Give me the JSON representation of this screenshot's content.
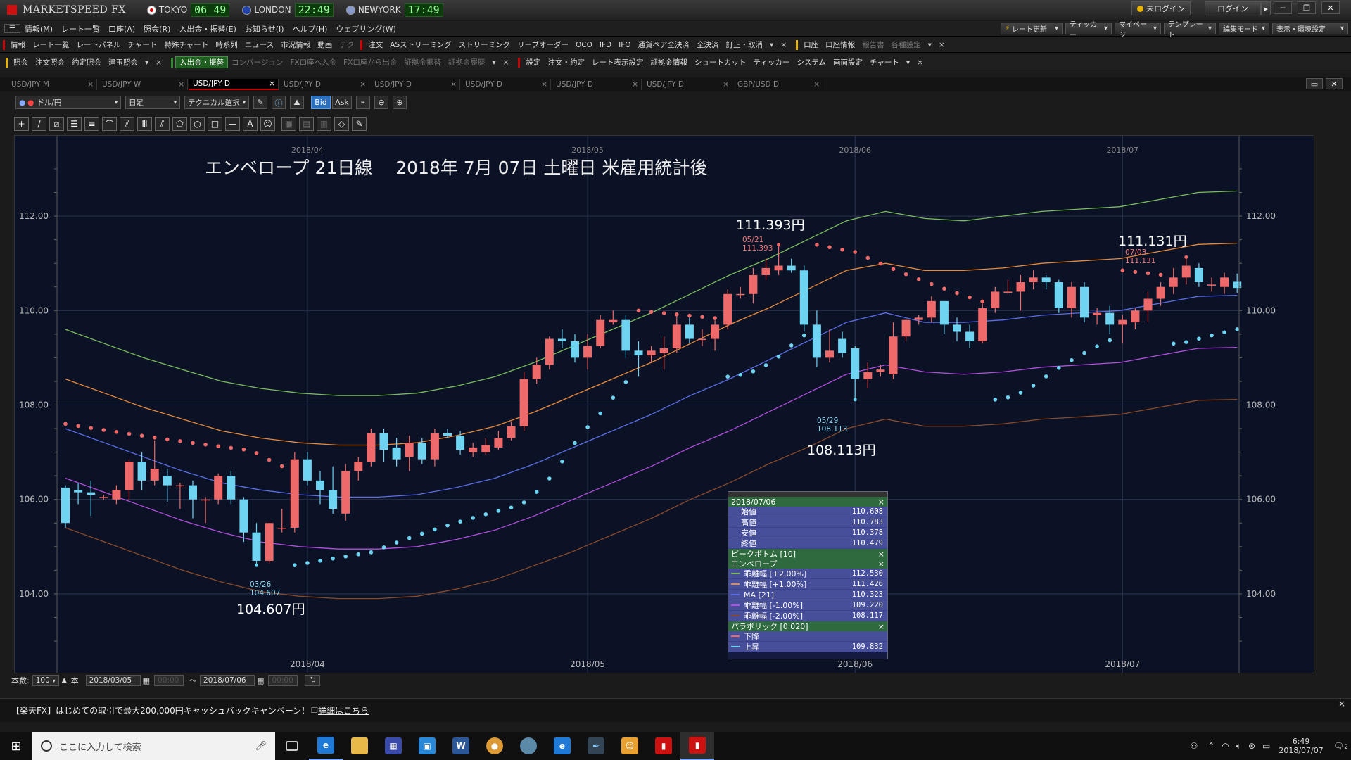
{
  "titlebar": {
    "app_name": "MARKETSPEED FX",
    "clocks": [
      {
        "city": "TOKYO",
        "time": "06 49",
        "flag_color": "#d00"
      },
      {
        "city": "LONDON",
        "time": "22:49",
        "flag_color": "#2244aa"
      },
      {
        "city": "NEWYORK",
        "time": "17:49",
        "flag_color": "#8899cc"
      }
    ],
    "login_status": "未ログイン",
    "login_button": "ログイン",
    "more": "▸",
    "minimize": "─",
    "restore": "❐",
    "close": "✕"
  },
  "menubar": {
    "items": [
      "情報(M)",
      "レート一覧",
      "口座(A)",
      "照会(R)",
      "入出金・振替(E)",
      "お知らせ(I)",
      "ヘルプ(H)",
      "ウェブリング(W)"
    ],
    "right_buttons": [
      "レート更新",
      "ティッカー",
      "マイページ",
      "テンプレート",
      "編集モード",
      "表示・環境設定"
    ]
  },
  "toolbar1": {
    "group1_label": "情報",
    "group1_items": [
      "レート一覧",
      "レートパネル",
      "チャート",
      "特殊チャート",
      "時系列",
      "ニュース",
      "市況情報",
      "動画",
      "テク"
    ],
    "group2_label": "注文",
    "group2_items": [
      "ASストリーミング",
      "ストリーミング",
      "リーブオーダー",
      "OCO",
      "IFD",
      "IFO",
      "通貨ペア全決済",
      "全決済",
      "訂正・取消"
    ],
    "group3_label": "口座",
    "group3_items": [
      "口座情報",
      "報告書",
      "各種設定"
    ],
    "close": "×",
    "dropdown": "▾"
  },
  "toolbar2": {
    "group1_label": "照会",
    "group1_items": [
      "注文照会",
      "約定照会",
      "建玉照会"
    ],
    "group2_label": "入出金・振替",
    "group2_items": [
      "コンバージョン",
      "FX口座へ入金",
      "FX口座から出金",
      "証拠金振替",
      "証拠金履歴"
    ],
    "group3_label": "設定",
    "group3_items": [
      "注文・約定",
      "レート表示設定",
      "証拠金情報",
      "ショートカット",
      "ティッカー",
      "システム",
      "画面設定",
      "チャート"
    ],
    "close": "×",
    "dropdown": "▾"
  },
  "tabs": [
    {
      "label": "USD/JPY M",
      "active": false
    },
    {
      "label": "USD/JPY W",
      "active": false
    },
    {
      "label": "USD/JPY D",
      "active": true
    },
    {
      "label": "USD/JPY D",
      "active": false
    },
    {
      "label": "USD/JPY D",
      "active": false
    },
    {
      "label": "USD/JPY D",
      "active": false
    },
    {
      "label": "USD/JPY D",
      "active": false
    },
    {
      "label": "USD/JPY D",
      "active": false
    },
    {
      "label": "GBP/USD D",
      "active": false
    }
  ],
  "tab_close": "×",
  "window_controls": {
    "restore": "▭",
    "close": "✕"
  },
  "charttool": {
    "pair": "ドル/円",
    "period": "日足",
    "technical": "テクニカル選択",
    "bid": "Bid",
    "ask": "Ask",
    "arrow": "▾"
  },
  "drawtools": [
    "+",
    "/",
    "⧄",
    "☰",
    "≡",
    "⌒",
    "⫽",
    "Ⅲ",
    "⫽",
    "⬠",
    "○",
    "□",
    "—",
    "A",
    "☺",
    "▣",
    "▤",
    "▥",
    "◇",
    "✎"
  ],
  "chart": {
    "headline": "エンベロープ 21日線　 2018年 7月 07日 土曜日 米雇用統計後",
    "annotations": {
      "high": {
        "label": "111.393円",
        "date": "05/21",
        "value": "111.393"
      },
      "recent_high": {
        "label": "111.131円",
        "date": "07/03",
        "value": "111.131"
      },
      "low_may": {
        "label": "108.113円",
        "date": "05/29",
        "value": "108.113"
      },
      "low_mar": {
        "label": "104.607円",
        "date": "03/26",
        "value": "104.607"
      }
    },
    "colors": {
      "background": "#0c1226",
      "up_candle": "#ee6a6a",
      "down_candle": "#6fd3f2",
      "env_plus2": "#7bbd5c",
      "env_plus1": "#e88a3a",
      "ma": "#5b6ee8",
      "env_minus1": "#b34fe0",
      "env_minus2": "#8a4a2a",
      "sar_up": "#6fd3f2",
      "sar_down": "#ee6a6a"
    }
  },
  "chart_data": {
    "type": "candlestick",
    "symbol": "USD/JPY",
    "period": "日足",
    "x_range": [
      "2018-03-05",
      "2018-07-06"
    ],
    "x_ticks": [
      "2018/04",
      "2018/05",
      "2018/06",
      "2018/07"
    ],
    "y_ticks": [
      "104.00",
      "106.00",
      "108.00",
      "110.00",
      "112.00"
    ],
    "ylim": [
      102.3,
      113.7
    ],
    "grid": true,
    "candles": [
      {
        "o": 106.25,
        "h": 106.3,
        "l": 105.4,
        "c": 105.5
      },
      {
        "o": 106.2,
        "h": 106.35,
        "l": 105.9,
        "c": 106.15
      },
      {
        "o": 106.15,
        "h": 106.4,
        "l": 105.65,
        "c": 106.1
      },
      {
        "o": 106.05,
        "h": 106.1,
        "l": 106.0,
        "c": 106.05
      },
      {
        "o": 106.0,
        "h": 106.3,
        "l": 105.9,
        "c": 106.2
      },
      {
        "o": 106.2,
        "h": 106.85,
        "l": 106.0,
        "c": 106.8
      },
      {
        "o": 106.8,
        "h": 107.0,
        "l": 106.2,
        "c": 106.4
      },
      {
        "o": 106.4,
        "h": 107.25,
        "l": 106.3,
        "c": 106.65
      },
      {
        "o": 106.5,
        "h": 106.65,
        "l": 105.95,
        "c": 106.3
      },
      {
        "o": 106.3,
        "h": 106.35,
        "l": 105.8,
        "c": 106.3
      },
      {
        "o": 106.3,
        "h": 106.4,
        "l": 105.6,
        "c": 106.0
      },
      {
        "o": 106.0,
        "h": 106.05,
        "l": 105.5,
        "c": 106.0
      },
      {
        "o": 106.0,
        "h": 106.55,
        "l": 105.9,
        "c": 106.5
      },
      {
        "o": 106.5,
        "h": 106.6,
        "l": 105.9,
        "c": 106.0
      },
      {
        "o": 106.0,
        "h": 106.05,
        "l": 105.1,
        "c": 105.3
      },
      {
        "o": 105.3,
        "h": 105.5,
        "l": 104.607,
        "c": 104.7
      },
      {
        "o": 104.7,
        "h": 105.5,
        "l": 104.65,
        "c": 105.5
      },
      {
        "o": 105.4,
        "h": 105.8,
        "l": 105.3,
        "c": 105.4
      },
      {
        "o": 105.4,
        "h": 107.0,
        "l": 105.3,
        "c": 106.85
      },
      {
        "o": 106.85,
        "h": 107.0,
        "l": 106.3,
        "c": 106.4
      },
      {
        "o": 106.4,
        "h": 106.6,
        "l": 105.9,
        "c": 106.2
      },
      {
        "o": 106.2,
        "h": 106.7,
        "l": 105.7,
        "c": 105.8
      },
      {
        "o": 105.7,
        "h": 106.75,
        "l": 105.55,
        "c": 106.6
      },
      {
        "o": 106.6,
        "h": 106.9,
        "l": 106.4,
        "c": 106.8
      },
      {
        "o": 106.8,
        "h": 107.5,
        "l": 106.7,
        "c": 107.4
      },
      {
        "o": 107.4,
        "h": 107.5,
        "l": 106.8,
        "c": 107.05
      },
      {
        "o": 107.1,
        "h": 107.3,
        "l": 106.7,
        "c": 106.85
      },
      {
        "o": 106.9,
        "h": 107.35,
        "l": 106.6,
        "c": 107.2
      },
      {
        "o": 107.2,
        "h": 107.3,
        "l": 106.75,
        "c": 106.85
      },
      {
        "o": 106.85,
        "h": 107.5,
        "l": 106.7,
        "c": 107.4
      },
      {
        "o": 107.4,
        "h": 107.5,
        "l": 107.3,
        "c": 107.35
      },
      {
        "o": 107.35,
        "h": 107.45,
        "l": 106.95,
        "c": 107.05
      },
      {
        "o": 107.0,
        "h": 107.2,
        "l": 106.9,
        "c": 107.1
      },
      {
        "o": 107.0,
        "h": 107.3,
        "l": 106.95,
        "c": 107.15
      },
      {
        "o": 107.1,
        "h": 107.45,
        "l": 107.05,
        "c": 107.3
      },
      {
        "o": 107.3,
        "h": 107.65,
        "l": 107.25,
        "c": 107.55
      },
      {
        "o": 107.55,
        "h": 108.7,
        "l": 107.45,
        "c": 108.55
      },
      {
        "o": 108.55,
        "h": 109.0,
        "l": 108.45,
        "c": 108.85
      },
      {
        "o": 108.85,
        "h": 109.45,
        "l": 108.75,
        "c": 109.4
      },
      {
        "o": 109.4,
        "h": 109.6,
        "l": 109.2,
        "c": 109.35
      },
      {
        "o": 109.35,
        "h": 109.5,
        "l": 108.9,
        "c": 109.0
      },
      {
        "o": 109.0,
        "h": 109.5,
        "l": 108.75,
        "c": 109.25
      },
      {
        "o": 109.25,
        "h": 109.9,
        "l": 109.2,
        "c": 109.8
      },
      {
        "o": 109.75,
        "h": 110.0,
        "l": 109.7,
        "c": 109.8
      },
      {
        "o": 109.8,
        "h": 109.9,
        "l": 109.0,
        "c": 109.15
      },
      {
        "o": 109.15,
        "h": 109.35,
        "l": 108.6,
        "c": 109.05
      },
      {
        "o": 109.05,
        "h": 109.25,
        "l": 108.9,
        "c": 109.15
      },
      {
        "o": 109.1,
        "h": 109.45,
        "l": 108.75,
        "c": 109.2
      },
      {
        "o": 109.2,
        "h": 109.9,
        "l": 109.1,
        "c": 109.7
      },
      {
        "o": 109.7,
        "h": 109.85,
        "l": 109.3,
        "c": 109.4
      },
      {
        "o": 109.4,
        "h": 109.6,
        "l": 109.25,
        "c": 109.4
      },
      {
        "o": 109.4,
        "h": 109.8,
        "l": 109.15,
        "c": 109.7
      },
      {
        "o": 109.7,
        "h": 110.45,
        "l": 109.6,
        "c": 110.35
      },
      {
        "o": 110.35,
        "h": 110.5,
        "l": 110.25,
        "c": 110.35
      },
      {
        "o": 110.35,
        "h": 110.9,
        "l": 110.15,
        "c": 110.75
      },
      {
        "o": 110.75,
        "h": 111.1,
        "l": 110.65,
        "c": 110.9
      },
      {
        "o": 110.85,
        "h": 111.393,
        "l": 110.75,
        "c": 110.95
      },
      {
        "o": 110.95,
        "h": 111.1,
        "l": 110.8,
        "c": 110.85
      },
      {
        "o": 110.85,
        "h": 110.95,
        "l": 109.55,
        "c": 109.7
      },
      {
        "o": 109.7,
        "h": 110.0,
        "l": 108.8,
        "c": 109.0
      },
      {
        "o": 109.0,
        "h": 109.6,
        "l": 108.9,
        "c": 109.15
      },
      {
        "o": 109.4,
        "h": 109.55,
        "l": 109.0,
        "c": 109.1
      },
      {
        "o": 109.2,
        "h": 109.25,
        "l": 108.113,
        "c": 108.55
      },
      {
        "o": 108.55,
        "h": 108.9,
        "l": 108.35,
        "c": 108.7
      },
      {
        "o": 108.7,
        "h": 108.85,
        "l": 108.6,
        "c": 108.75
      },
      {
        "o": 108.65,
        "h": 109.75,
        "l": 108.55,
        "c": 109.45
      },
      {
        "o": 109.45,
        "h": 109.8,
        "l": 109.35,
        "c": 109.8
      },
      {
        "o": 109.8,
        "h": 109.9,
        "l": 109.7,
        "c": 109.85
      },
      {
        "o": 109.85,
        "h": 110.3,
        "l": 109.75,
        "c": 110.2
      },
      {
        "o": 110.2,
        "h": 110.2,
        "l": 109.5,
        "c": 109.7
      },
      {
        "o": 109.7,
        "h": 109.85,
        "l": 109.35,
        "c": 109.55
      },
      {
        "o": 109.55,
        "h": 109.7,
        "l": 109.2,
        "c": 109.35
      },
      {
        "o": 109.35,
        "h": 110.15,
        "l": 109.3,
        "c": 110.05
      },
      {
        "o": 110.05,
        "h": 110.5,
        "l": 109.95,
        "c": 110.4
      },
      {
        "o": 110.4,
        "h": 110.65,
        "l": 110.35,
        "c": 110.4
      },
      {
        "o": 110.4,
        "h": 110.75,
        "l": 110.0,
        "c": 110.6
      },
      {
        "o": 110.6,
        "h": 110.85,
        "l": 110.45,
        "c": 110.7
      },
      {
        "o": 110.7,
        "h": 110.75,
        "l": 110.45,
        "c": 110.6
      },
      {
        "o": 110.6,
        "h": 110.65,
        "l": 109.95,
        "c": 110.05
      },
      {
        "o": 110.05,
        "h": 110.6,
        "l": 109.85,
        "c": 110.5
      },
      {
        "o": 110.5,
        "h": 110.6,
        "l": 109.75,
        "c": 109.85
      },
      {
        "o": 109.9,
        "h": 110.05,
        "l": 109.7,
        "c": 109.95
      },
      {
        "o": 109.95,
        "h": 110.1,
        "l": 109.5,
        "c": 109.7
      },
      {
        "o": 109.7,
        "h": 109.9,
        "l": 109.3,
        "c": 109.8
      },
      {
        "o": 109.75,
        "h": 110.05,
        "l": 109.6,
        "c": 110.0
      },
      {
        "o": 110.0,
        "h": 110.4,
        "l": 109.75,
        "c": 110.25
      },
      {
        "o": 110.25,
        "h": 110.6,
        "l": 110.1,
        "c": 110.5
      },
      {
        "o": 110.5,
        "h": 110.9,
        "l": 110.35,
        "c": 110.7
      },
      {
        "o": 110.7,
        "h": 111.131,
        "l": 110.55,
        "c": 110.95
      },
      {
        "o": 110.9,
        "h": 111.0,
        "l": 110.5,
        "c": 110.6
      },
      {
        "o": 110.55,
        "h": 110.7,
        "l": 110.4,
        "c": 110.55
      },
      {
        "o": 110.5,
        "h": 110.8,
        "l": 110.35,
        "c": 110.7
      },
      {
        "o": 110.608,
        "h": 110.783,
        "l": 110.378,
        "c": 110.479
      }
    ],
    "envelope": {
      "period": 21,
      "plus2": [
        109.6,
        109.3,
        109.0,
        108.75,
        108.5,
        108.35,
        108.25,
        108.2,
        108.2,
        108.25,
        108.4,
        108.6,
        108.9,
        109.25,
        109.6,
        109.95,
        110.35,
        110.75,
        111.1,
        111.5,
        111.9,
        112.1,
        111.95,
        111.9,
        112.0,
        112.1,
        112.15,
        112.2,
        112.35,
        112.5,
        112.53
      ],
      "plus1": [
        108.55,
        108.25,
        107.95,
        107.7,
        107.45,
        107.3,
        107.2,
        107.15,
        107.15,
        107.2,
        107.35,
        107.55,
        107.85,
        108.2,
        108.55,
        108.9,
        109.3,
        109.7,
        110.05,
        110.45,
        110.85,
        111.0,
        110.85,
        110.85,
        110.9,
        111.0,
        111.05,
        111.1,
        111.25,
        111.4,
        111.426
      ],
      "ma": [
        107.5,
        107.2,
        106.9,
        106.6,
        106.35,
        106.2,
        106.1,
        106.05,
        106.05,
        106.1,
        106.25,
        106.45,
        106.75,
        107.1,
        107.45,
        107.8,
        108.2,
        108.55,
        108.95,
        109.35,
        109.75,
        109.95,
        109.75,
        109.75,
        109.8,
        109.9,
        109.95,
        110.0,
        110.15,
        110.3,
        110.323
      ],
      "minus1": [
        106.45,
        106.15,
        105.85,
        105.55,
        105.3,
        105.1,
        105.0,
        104.95,
        104.95,
        105.0,
        105.15,
        105.35,
        105.65,
        106.0,
        106.35,
        106.7,
        107.1,
        107.45,
        107.85,
        108.25,
        108.65,
        108.85,
        108.7,
        108.65,
        108.7,
        108.8,
        108.85,
        108.9,
        109.05,
        109.2,
        109.22
      ],
      "minus2": [
        105.4,
        105.1,
        104.8,
        104.5,
        104.25,
        104.05,
        103.95,
        103.9,
        103.9,
        103.95,
        104.1,
        104.3,
        104.6,
        104.9,
        105.25,
        105.6,
        106.0,
        106.35,
        106.75,
        107.1,
        107.5,
        107.7,
        107.55,
        107.55,
        107.6,
        107.7,
        107.75,
        107.8,
        107.95,
        108.1,
        108.117
      ]
    },
    "info_panel": {
      "date": "2018/07/06",
      "ohlc": [
        {
          "label": "始値",
          "value": "110.608"
        },
        {
          "label": "高値",
          "value": "110.783"
        },
        {
          "label": "安値",
          "value": "110.378"
        },
        {
          "label": "終値",
          "value": "110.479"
        }
      ],
      "peak_bottom": "ピークボトム [10]",
      "envelope_header": "エンベロープ",
      "envelope_rows": [
        {
          "label": "乖離幅 [+2.00%]",
          "value": "112.530",
          "color": "#7bbd5c"
        },
        {
          "label": "乖離幅 [+1.00%]",
          "value": "111.426",
          "color": "#e88a3a"
        },
        {
          "label": "MA [21]",
          "value": "110.323",
          "color": "#5b6ee8"
        },
        {
          "label": "乖離幅 [-1.00%]",
          "value": "109.220",
          "color": "#b34fe0"
        },
        {
          "label": "乖離幅 [-2.00%]",
          "value": "108.117",
          "color": "#8a4a2a"
        }
      ],
      "parabolic_header": "パラボリック [0.020]",
      "parabolic_rows": [
        {
          "label": "下降",
          "value": "",
          "color": "#ee6a6a"
        },
        {
          "label": "上昇",
          "value": "109.832",
          "color": "#6fd3f2"
        }
      ],
      "close": "×"
    }
  },
  "bottombar": {
    "count_label": "本数:",
    "count": "100",
    "count_unit": "本",
    "from_date": "2018/03/05",
    "from_time": "00:00",
    "tilde": "〜",
    "to_date": "2018/07/06",
    "to_time": "00:00",
    "refresh": "⮌"
  },
  "adbar": {
    "text": "【楽天FX】はじめての取引で最大200,000円キャッシュバックキャンペーン！",
    "link": "詳細はこちら",
    "close": "×"
  },
  "taskbar": {
    "search_placeholder": "ここに入力して検索",
    "time": "6:49",
    "date": "2018/07/07",
    "notifications": "2"
  }
}
